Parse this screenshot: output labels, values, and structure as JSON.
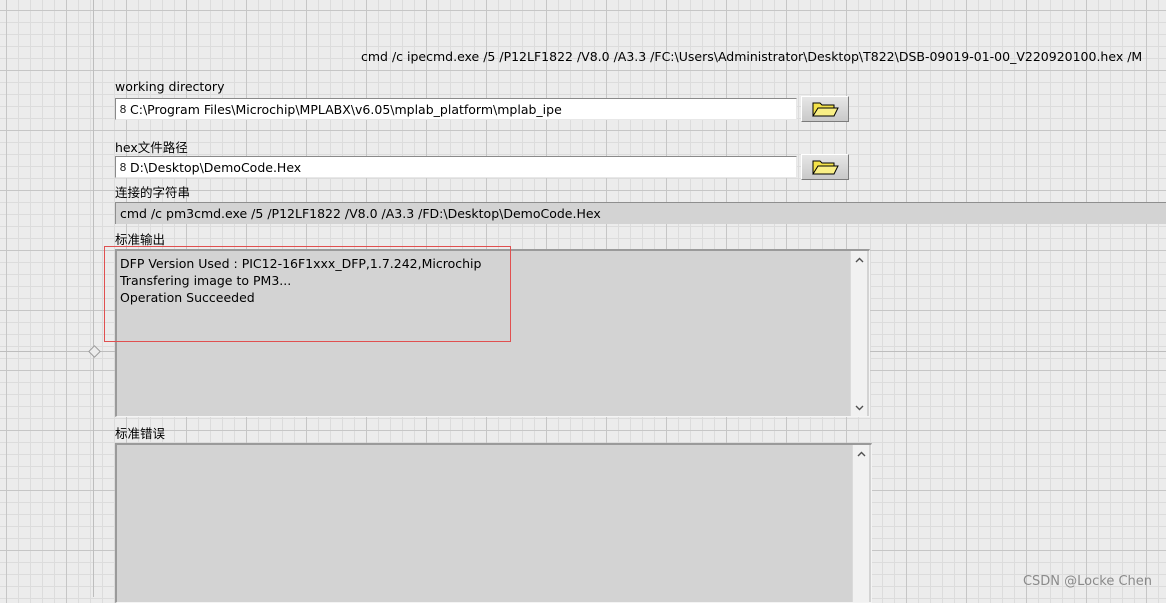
{
  "top_command": "cmd /c ipecmd.exe  /5 /P12LF1822 /V8.0 /A3.3 /FC:\\Users\\Administrator\\Desktop\\T822\\DSB-09019-01-00_V220920100.hex /M",
  "working_directory": {
    "label": "working directory",
    "prefix": "8",
    "value": "C:\\Program Files\\Microchip\\MPLABX\\v6.05\\mplab_platform\\mplab_ipe"
  },
  "hex_path": {
    "label": "hex文件路径",
    "prefix": "8",
    "value": "D:\\Desktop\\DemoCode.Hex"
  },
  "concatenated": {
    "label": "连接的字符串",
    "value": "cmd /c pm3cmd.exe  /5 /P12LF1822 /V8.0 /A3.3 /FD:\\Desktop\\DemoCode.Hex"
  },
  "stdout": {
    "label": "标准输出",
    "lines": [
      "DFP Version Used : PIC12-16F1xxx_DFP,1.7.242,Microchip",
      "Transfering image to PM3...",
      "Operation Succeeded"
    ]
  },
  "stderr": {
    "label": "标准错误",
    "lines": []
  },
  "icons": {
    "browse": "folder-open-icon",
    "scroll_up": "chevron-up-icon",
    "scroll_down": "chevron-down-icon"
  },
  "colors": {
    "highlight": "#e05050",
    "folder": "#f4e34a"
  },
  "watermark": "CSDN @Locke Chen"
}
